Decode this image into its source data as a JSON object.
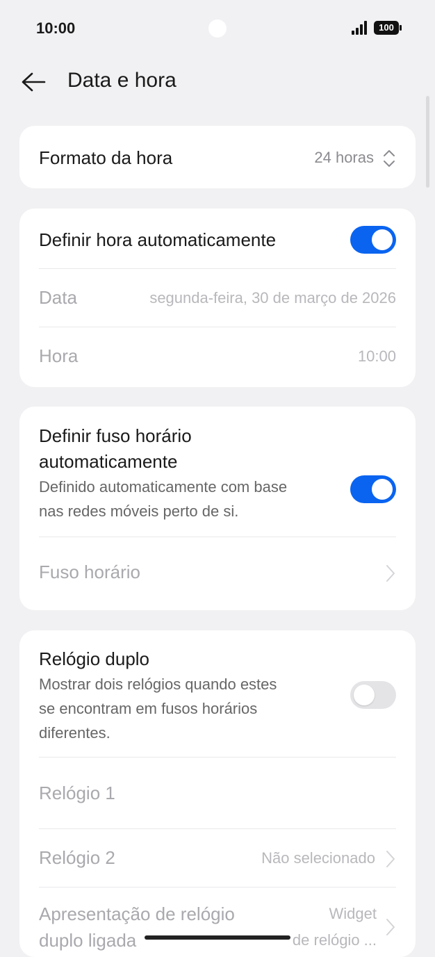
{
  "status": {
    "time": "10:00",
    "battery": "100"
  },
  "header": {
    "title": "Data e hora"
  },
  "time_format": {
    "label": "Formato da hora",
    "value": "24 horas"
  },
  "auto_time": {
    "label": "Definir hora automaticamente",
    "enabled": true,
    "date_label": "Data",
    "date_value": "segunda-feira, 30 de março de 2026",
    "time_label": "Hora",
    "time_value": "10:00"
  },
  "auto_timezone": {
    "label_line1": "Definir fuso horário",
    "label_line2": "automaticamente",
    "desc_line1": "Definido automaticamente com base",
    "desc_line2": "nas redes móveis perto de si.",
    "enabled": true,
    "timezone_label": "Fuso horário"
  },
  "dual_clock": {
    "label": "Relógio duplo",
    "desc_line1": "Mostrar dois relógios quando estes",
    "desc_line2": "se encontram em fusos horários",
    "desc_line3": "diferentes.",
    "enabled": false,
    "clock1_label": "Relógio 1",
    "clock2_label": "Relógio 2",
    "clock2_value": "Não selecionado",
    "display_label_line1": "Apresentação de relógio",
    "display_label_line2": "duplo ligada",
    "display_value_line1": "Widget",
    "display_value_line2": "de relógio ..."
  },
  "colors": {
    "accent": "#0a64f0",
    "background": "#f1f1f3",
    "card": "#ffffff"
  }
}
